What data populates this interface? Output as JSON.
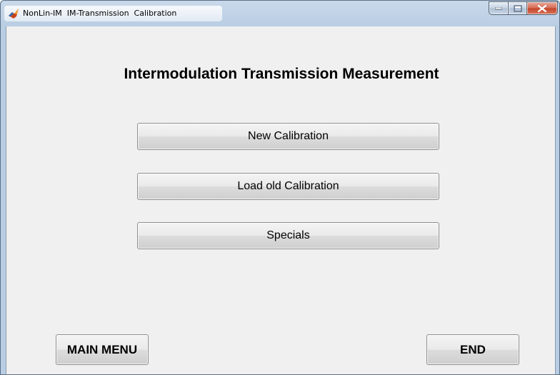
{
  "window": {
    "title": "NonLin-IM  IM-Transmission  Calibration",
    "controls": {
      "minimize_icon": "minimize-icon",
      "maximize_icon": "maximize-icon",
      "close_icon": "close-icon"
    }
  },
  "main": {
    "heading": "Intermodulation Transmission Measurement",
    "buttons": {
      "new_calibration": "New Calibration",
      "load_old_calibration": "Load old Calibration",
      "specials": "Specials"
    }
  },
  "footer": {
    "main_menu": "MAIN MENU",
    "end": "END"
  },
  "colors": {
    "client_background": "#f0f0f0",
    "titlebar": "#b9cde3",
    "close_button": "#c2442a"
  }
}
